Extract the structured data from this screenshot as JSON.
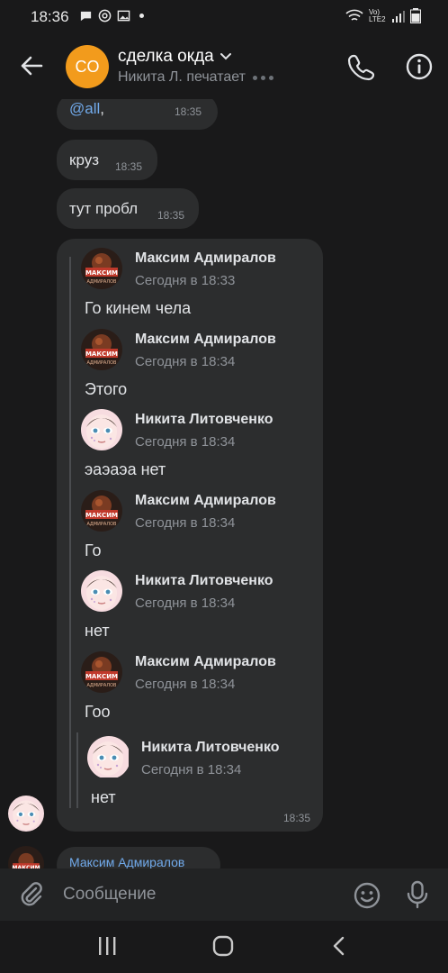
{
  "status_bar": {
    "time": "18:36",
    "network": "Vo) LTE2"
  },
  "header": {
    "avatar_initials": "CO",
    "title": "сделка окда",
    "subtitle": "Никита Л. печатает"
  },
  "messages": [
    {
      "text_mention": "@all",
      "text_suffix": ",",
      "time": "18:35"
    },
    {
      "text": "круз",
      "time": "18:35"
    },
    {
      "text": "тут пробл",
      "time": "18:35"
    }
  ],
  "forwarded": {
    "time": "18:35",
    "items": [
      {
        "author": "Максим Адмиралов",
        "date": "Сегодня в 18:33",
        "text": "Го кинем чела",
        "avatar": "maksim"
      },
      {
        "author": "Максим Адмиралов",
        "date": "Сегодня в 18:34",
        "text": "Этого",
        "avatar": "maksim"
      },
      {
        "author": "Никита Литовченко",
        "date": "Сегодня в 18:34",
        "text": "эаэаэа нет",
        "avatar": "nikita"
      },
      {
        "author": "Максим Адмиралов",
        "date": "Сегодня в 18:34",
        "text": "Го",
        "avatar": "maksim"
      },
      {
        "author": "Никита Литовченко",
        "date": "Сегодня в 18:34",
        "text": "нет",
        "avatar": "nikita"
      },
      {
        "author": "Максим Адмиралов",
        "date": "Сегодня в 18:34",
        "text": "Гоо",
        "avatar": "maksim"
      }
    ],
    "nested": {
      "author": "Никита Литовченко",
      "date": "Сегодня в 18:34",
      "text": "нет",
      "avatar": "nikita"
    }
  },
  "partial_message": {
    "author": "Максим Адмиралов"
  },
  "composer": {
    "placeholder": "Сообщение"
  },
  "colors": {
    "accent": "#71aaeb",
    "avatar_co": "#f29b1c",
    "bubble": "#2c2d2e",
    "background": "#19191a"
  }
}
